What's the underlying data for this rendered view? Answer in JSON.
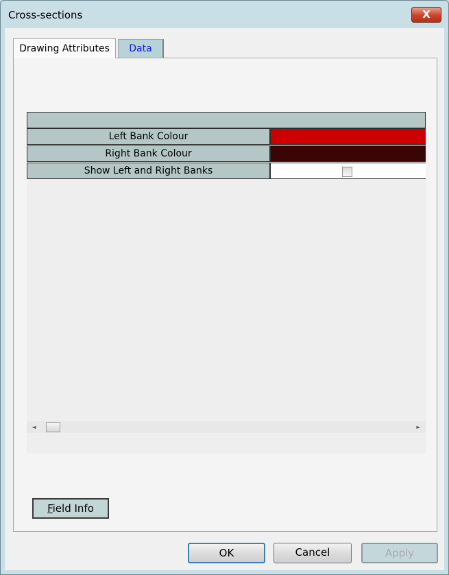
{
  "window": {
    "title": "Cross-sections",
    "close_label": "X"
  },
  "tabs": [
    {
      "label": "Drawing Attributes",
      "active": true
    },
    {
      "label": "Data",
      "active": false
    }
  ],
  "grid": {
    "rows": [
      {
        "label": "Left Bank Colour",
        "value_color": "#cc0000"
      },
      {
        "label": "Right Bank Colour",
        "value_color": "#3a0505"
      },
      {
        "label": "Show Left and Right Banks",
        "checked": false
      }
    ]
  },
  "buttons": {
    "field_info_mnemonic": "F",
    "field_info_rest": "ield Info",
    "ok": "OK",
    "cancel": "Cancel",
    "apply": "Apply"
  }
}
